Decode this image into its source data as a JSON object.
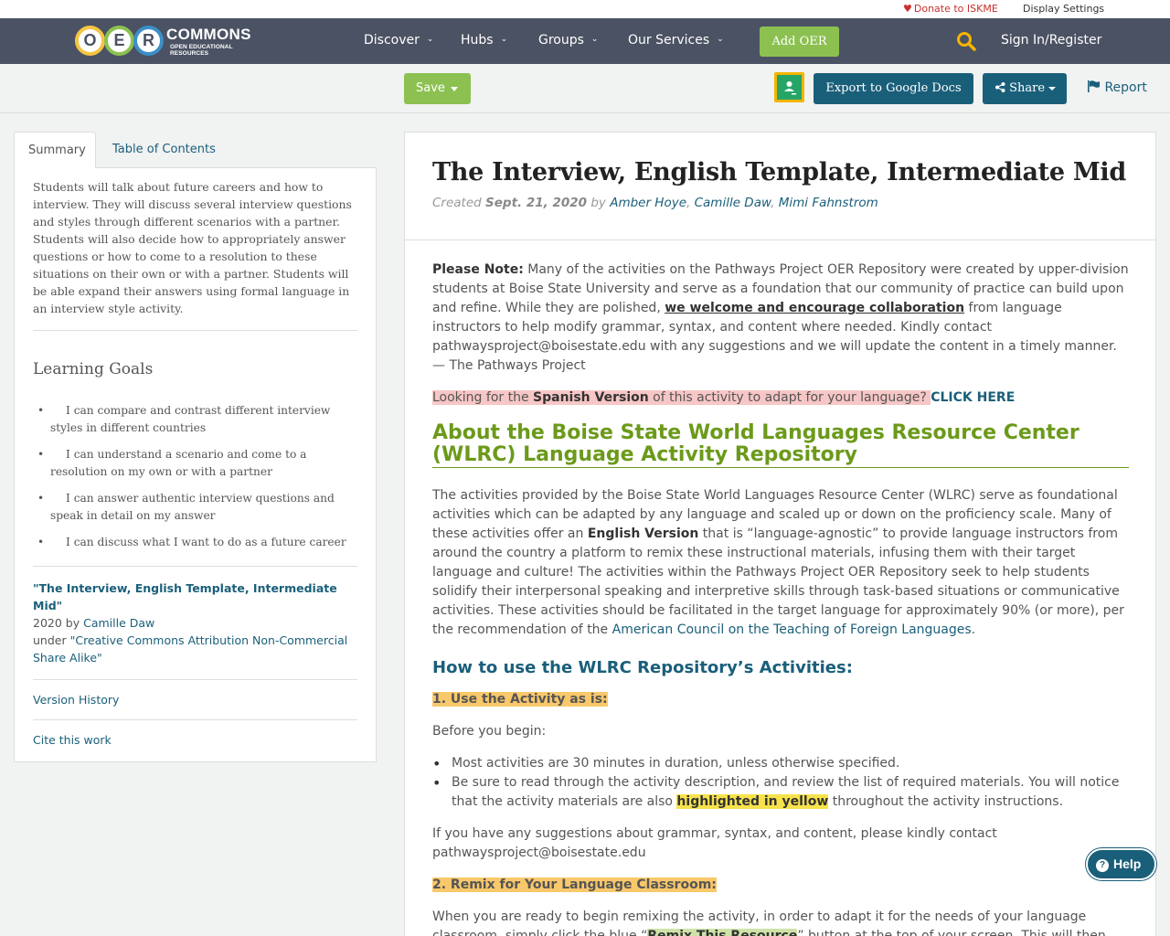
{
  "util_bar": {
    "donate": "Donate to ISKME",
    "display_settings": "Display Settings"
  },
  "nav": {
    "logo_letters": [
      "O",
      "E",
      "R"
    ],
    "logo_name": "COMMONS",
    "logo_sub": "OPEN EDUCATIONAL RESOURCES",
    "items": [
      {
        "label": "Discover"
      },
      {
        "label": "Hubs"
      },
      {
        "label": "Groups"
      },
      {
        "label": "Our Services"
      }
    ],
    "add_oer": "Add OER",
    "signin": "Sign In/Register"
  },
  "toolbar": {
    "save": "Save",
    "export": "Export to Google Docs",
    "share": "Share",
    "report": "Report"
  },
  "left": {
    "tabs": [
      "Summary",
      "Table of Contents"
    ],
    "summary": "Students will talk about future careers and how to interview. They will discuss several interview questions and styles through different scenarios with a partner. Students will also decide how to appropriately answer questions or how to come to a resolution to these situations on their own or with a partner. Students will be able expand their answers using formal language in an interview style activity.",
    "goals_title": "Learning Goals",
    "goals": [
      "I can compare and contrast different interview styles in different countries",
      "I can understand a scenario and come to a resolution on my own or with a partner",
      "I can answer authentic interview questions and speak in detail on my answer",
      "I can discuss what I want to do as a future career"
    ],
    "attr_title": "\"The Interview, English Template, Intermediate Mid\"",
    "attr_year": "2020 by ",
    "attr_author": "Camille Daw",
    "attr_under": "under ",
    "attr_license": "\"Creative Commons Attribution Non-Commercial Share Alike\"",
    "version_history": "Version History",
    "cite": "Cite this work"
  },
  "main": {
    "title": "The Interview, English Template, Intermediate Mid",
    "created": "Created",
    "date": "Sept. 21, 2020",
    "by": "by",
    "authors": [
      "Amber Hoye",
      "Camille Daw",
      "Mimi Fahnstrom"
    ],
    "note_label": "Please Note:",
    "note_1": " Many of the activities on the Pathways Project OER Repository were created by upper-division students at Boise State University and serve as a foundation that our community of practice can build upon and refine. While they are polished, ",
    "note_bold": "we welcome and encourage collaboration",
    "note_2": " from language instructors to help modify grammar, syntax, and content where needed. Kindly contact pathwaysproject@boisestate.edu with any suggestions and we will update the content in a timely manner.  — The Pathways Project",
    "spanish_1": "Looking for the ",
    "spanish_bold": "Spanish Version",
    "spanish_2": " of this activity to adapt for your language? ",
    "click_here": "CLICK HERE",
    "about_heading": "About the Boise State World Languages Resource Center (WLRC) Language Activity Repository",
    "about_1": "The activities provided by the Boise State World Languages Resource Center (WLRC) serve as foundational activities which can be adapted by any language and scaled up or down on the proficiency scale. Many of these activities offer an ",
    "about_bold": "English Version",
    "about_2": " that is “language-agnostic” to provide language instructors from around the country a platform to remix these instructional materials, infusing them with their target language and culture! The activities within the Pathways Project OER Repository seek to help students solidify their interpersonal speaking and interpretive skills through task-based situations or communicative activities. These activities should be facilitated in the target language for approximately 90% (or more), per the recommendation of the ",
    "about_link": "American Council on the Teaching of Foreign Languages",
    "about_end": ".",
    "how_heading": "How to use the WLRC Repository’s Activities:",
    "step1": "1. Use the Activity as is:",
    "before": "Before you begin:",
    "bullet1": "Most activities are 30 minutes in duration, unless otherwise specified.",
    "bullet2_1": "Be sure to read through the activity description, and review the list of required materials. You will notice that the activity materials are also ",
    "bullet2_hl": "highlighted in yellow",
    "bullet2_2": " throughout the activity instructions.",
    "suggest": "If you have any suggestions about grammar, syntax, and content, please kindly contact pathwaysproject@boisestate.edu",
    "step2": "2. Remix for Your Language Classroom:",
    "remix_1": "When you are ready to begin remixing the activity, in order to adapt it for the needs of your language classroom, simply click the blue “",
    "remix_hl": "Remix This Resource",
    "remix_2": "” button at the top of your screen. This will then take you to a screen"
  },
  "help": "Help",
  "colors": {
    "nav_bg": "#4b5263",
    "green": "#8cc151",
    "teal": "#1a5f7a",
    "heading_green": "#6b9a1a"
  }
}
